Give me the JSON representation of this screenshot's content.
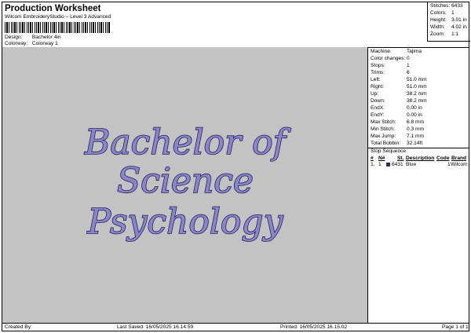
{
  "header": {
    "title": "Production Worksheet",
    "subtitle": "Wilcom EmbroideryStudio – Level 3 Advanced",
    "design_label": "Design:",
    "design_value": "Bachelor 4in",
    "colorway_label": "Colorway:",
    "colorway_value": "Colorway 1"
  },
  "stats": [
    {
      "label": "Stitches:",
      "value": "6433"
    },
    {
      "label": "Colors:",
      "value": "1"
    },
    {
      "label": "Height:",
      "value": "3.01 in"
    },
    {
      "label": "Width:",
      "value": "4.02 in"
    },
    {
      "label": "Zoom:",
      "value": "1:1"
    }
  ],
  "design_text": [
    "Bachelor of",
    "Science",
    "Psychology"
  ],
  "colors": {
    "thread_fill": "#8a86c9",
    "thread_outline": "#25205c",
    "swatch": "#2e2a6e",
    "background": "#c3c3c3"
  },
  "info": [
    {
      "label": "Machine:",
      "value": "Tajima"
    },
    {
      "label": "Color changes:",
      "value": "0"
    },
    {
      "label": "Stops:",
      "value": "1"
    },
    {
      "label": "Trims:",
      "value": "6"
    },
    {
      "label": "Left:",
      "value": "51.0 mm"
    },
    {
      "label": "Right:",
      "value": "51.0 mm"
    },
    {
      "label": "Up:",
      "value": "38.2 mm"
    },
    {
      "label": "Down:",
      "value": "38.2 mm"
    },
    {
      "label": "EndX:",
      "value": "0.00 in"
    },
    {
      "label": "EndY:",
      "value": "0.00 in"
    },
    {
      "label": "Max Stitch:",
      "value": "6.8 mm"
    },
    {
      "label": "Min Stitch:",
      "value": "0.3 mm"
    },
    {
      "label": "Max Jump:",
      "value": "7.1 mm"
    },
    {
      "label": "Total Bobbin:",
      "value": "32.14ft"
    }
  ],
  "stop_sequence": {
    "title": "Stop Sequence:",
    "headers": [
      "#",
      "N#",
      "St.",
      "Description",
      "Code",
      "Brand"
    ],
    "rows": [
      [
        "1.",
        "1",
        "6431",
        "Blue",
        "1",
        "Wilcom"
      ]
    ]
  },
  "footer": {
    "created_by": "Created By:",
    "last_saved": "Last Saved: 16/05/2025 16.14.59",
    "printed": "Printed: 16/05/2025 16.15.02",
    "page": "Page 1 of 1"
  }
}
